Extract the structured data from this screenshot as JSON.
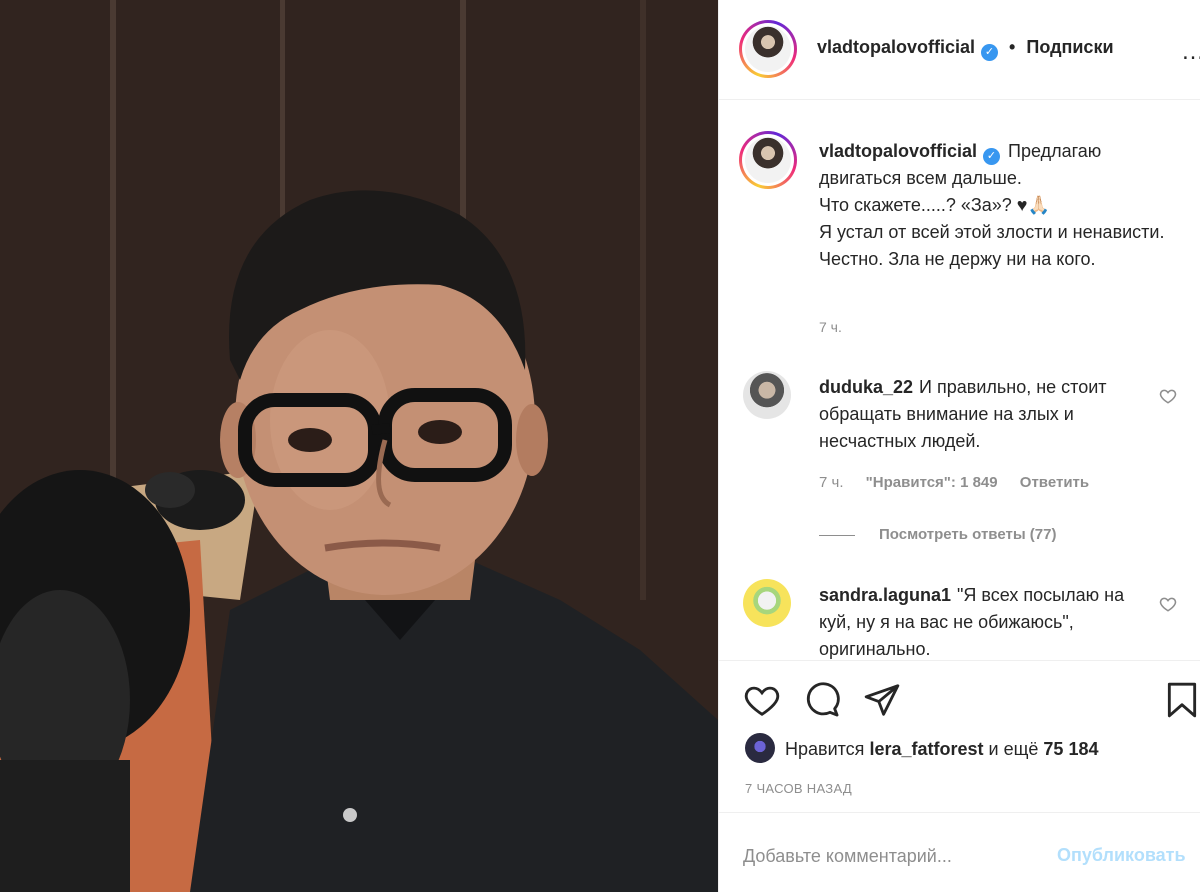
{
  "post": {
    "author": "vladtopalovofficial",
    "follow_state": "Подписки",
    "dot": "•",
    "more_glyph": "…"
  },
  "caption": {
    "username": "vladtopalovofficial",
    "text_line1": "Предлагаю двигаться всем дальше.",
    "text_line2": "Что скажете.....? «За»? ♥🙏🏻",
    "text_line3": "Я устал от всей этой злости и ненависти. Честно. Зла не держу ни на кого.",
    "time": "7 ч."
  },
  "comments": [
    {
      "username": "duduka_22",
      "text": "И правильно, не стоит обращать внимание на злых и несчастных людей.",
      "time": "7 ч.",
      "likes_label": "\"Нравится\": 1 849",
      "reply_label": "Ответить",
      "view_replies": "Посмотреть ответы (77)"
    },
    {
      "username": "sandra.laguna1",
      "text": "\"Я всех посылаю на куй, ну я на вас не обижаюсь\", оригинально."
    }
  ],
  "likes": {
    "prefix": "Нравится",
    "liker": "lera_fatforest",
    "suffix": "и ещё",
    "count": "75 184"
  },
  "posted_ago": "7 ЧАСОВ НАЗАД",
  "add_comment": {
    "placeholder": "Добавьте комментарий...",
    "post_label": "Опубликовать"
  },
  "colors": {
    "verified": "#3897f0",
    "post_button_disabled": "#b2dffc",
    "muted": "#8e8e8e"
  },
  "icons": [
    "heart-icon",
    "comment-icon",
    "share-icon",
    "bookmark-icon",
    "verified-badge-icon",
    "more-icon"
  ]
}
